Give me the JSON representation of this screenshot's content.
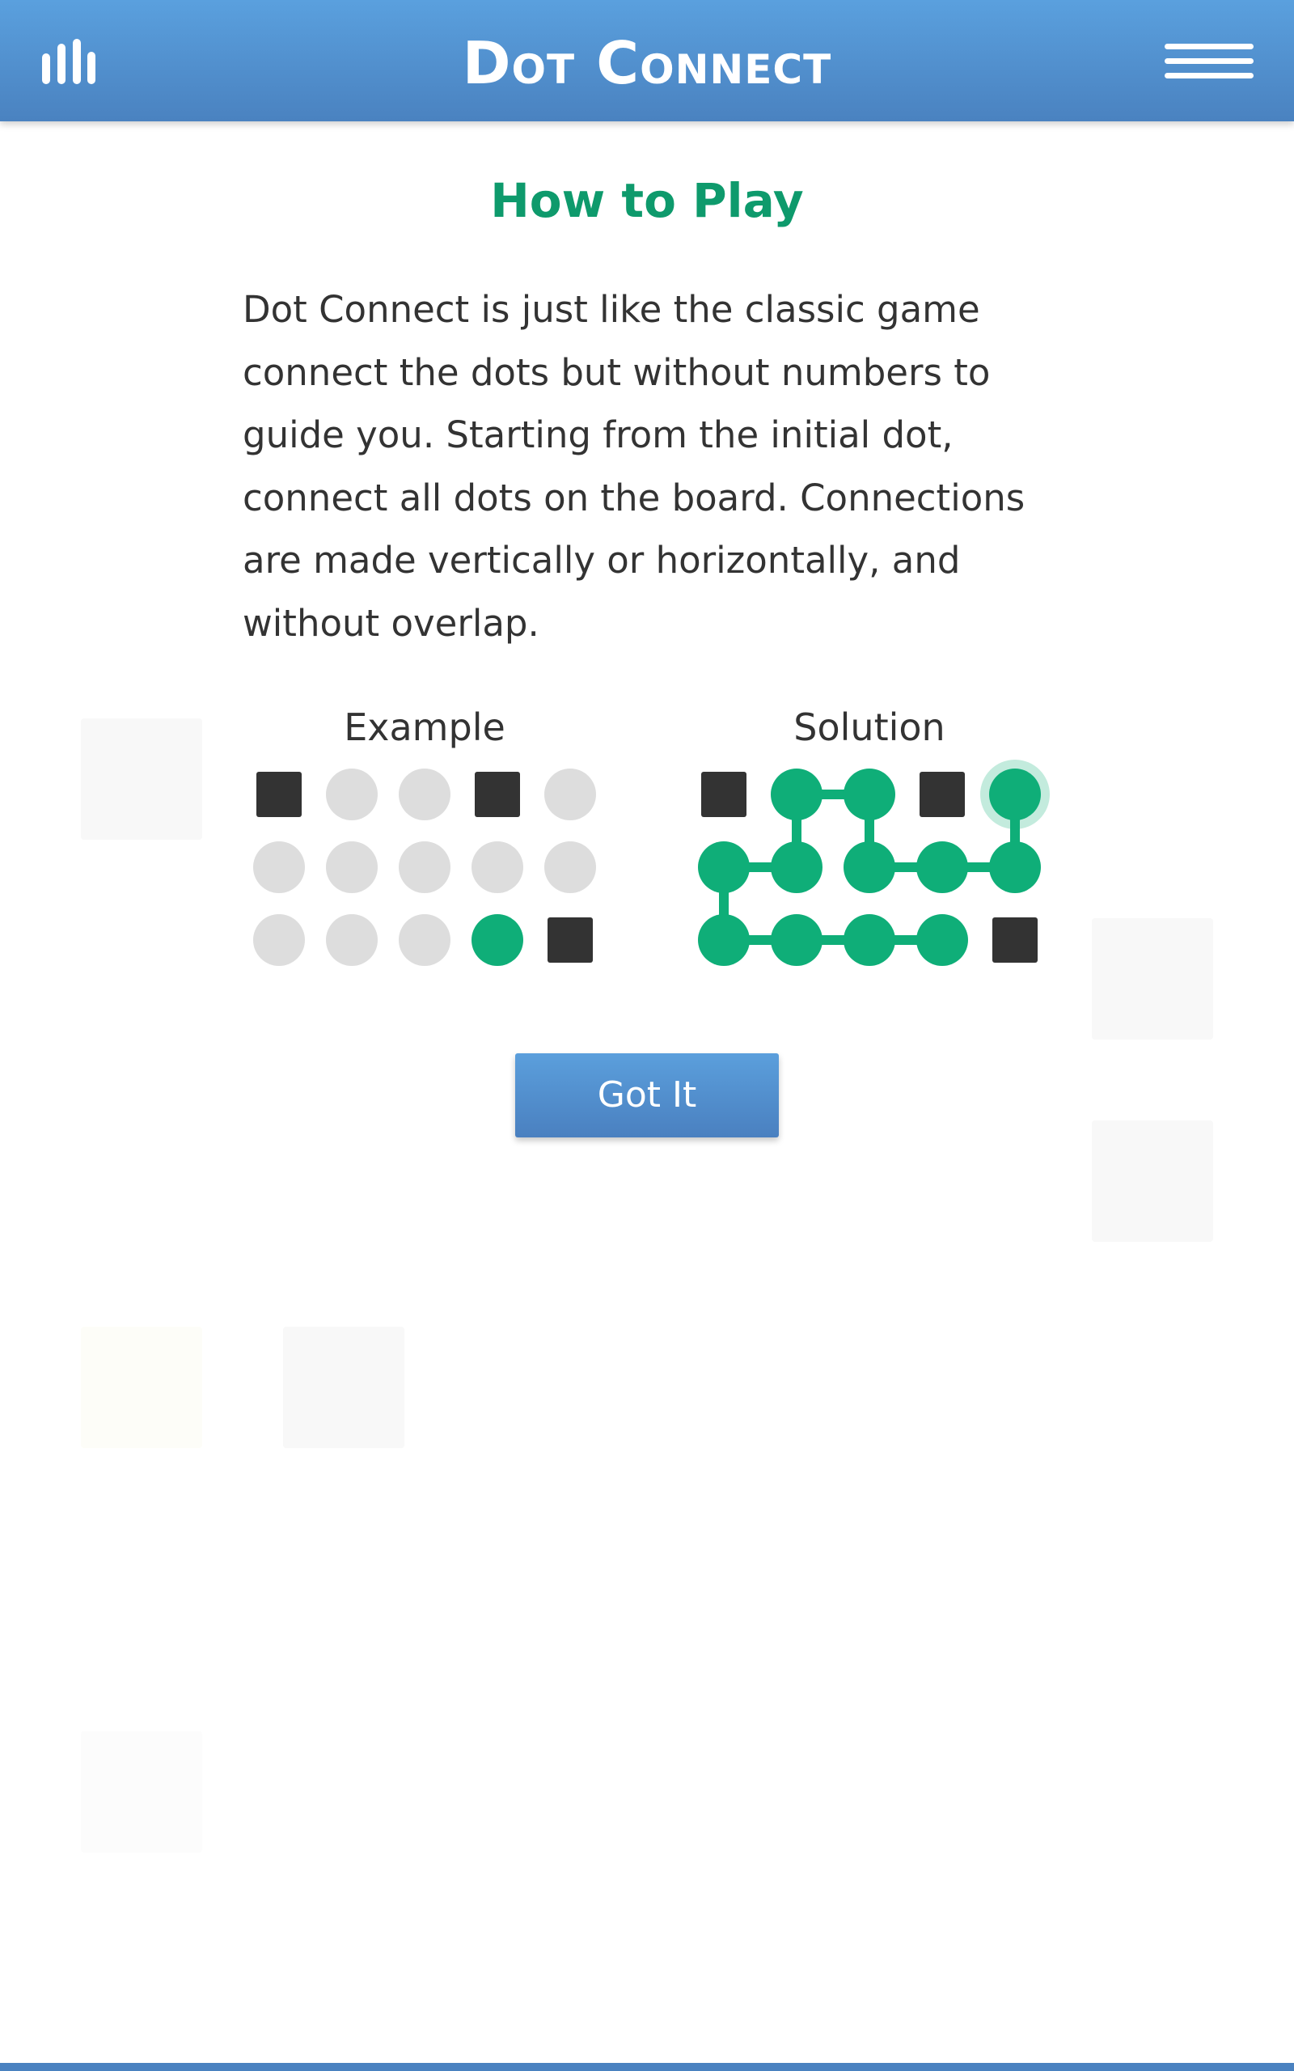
{
  "header": {
    "title": "Dot Connect",
    "stats_icon": "bar-chart-icon",
    "menu_icon": "hamburger-menu-icon"
  },
  "modal": {
    "title": "How to Play",
    "instructions": "Dot Connect is just like the classic game connect the dots but without numbers to guide you. Starting from the initial dot, connect all dots on the board. Connections are made vertically or horizontally, and without overlap.",
    "example_label": "Example",
    "solution_label": "Solution",
    "button_label": "Got It"
  },
  "colors": {
    "header_blue": "#4f8fd0",
    "accent_green": "#0fae78",
    "title_green": "#0e9a6c",
    "empty_dot": "#dddddd",
    "wall": "#333333"
  },
  "example_board": {
    "rows": 3,
    "cols": 5,
    "cells": [
      [
        "wall",
        "empty",
        "empty",
        "wall",
        "empty"
      ],
      [
        "empty",
        "empty",
        "empty",
        "empty",
        "empty"
      ],
      [
        "empty",
        "empty",
        "empty",
        "start",
        "wall"
      ]
    ]
  },
  "solution_board": {
    "rows": 3,
    "cols": 5,
    "cells": [
      [
        "wall",
        "filled",
        "filled",
        "wall",
        "end"
      ],
      [
        "filled",
        "filled",
        "filled",
        "filled",
        "filled"
      ],
      [
        "filled",
        "filled",
        "filled",
        "filled",
        "wall"
      ]
    ],
    "path": [
      [
        2,
        3
      ],
      [
        2,
        2
      ],
      [
        2,
        1
      ],
      [
        2,
        0
      ],
      [
        1,
        0
      ],
      [
        1,
        1
      ],
      [
        0,
        1
      ],
      [
        0,
        2
      ],
      [
        1,
        2
      ],
      [
        1,
        3
      ],
      [
        1,
        4
      ],
      [
        0,
        4
      ]
    ]
  }
}
